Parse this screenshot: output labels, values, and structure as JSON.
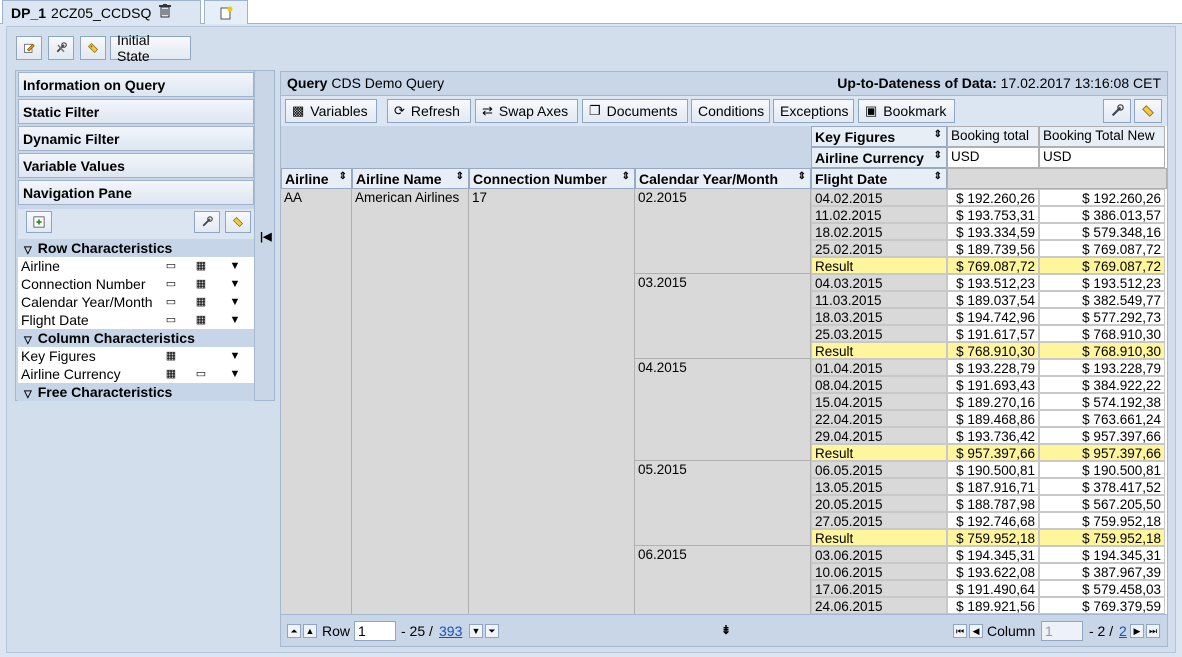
{
  "tabs": {
    "active": {
      "title": "DP_1",
      "subtitle": "2CZ05_CCDSQ"
    }
  },
  "toolbar": {
    "initial_state": "Initial State"
  },
  "nav": {
    "items": [
      "Information on Query",
      "Static Filter",
      "Dynamic Filter",
      "Variable Values",
      "Navigation Pane"
    ],
    "row_section": "Row Characteristics",
    "row_items": [
      "Airline",
      "Connection Number",
      "Calendar Year/Month",
      "Flight Date"
    ],
    "col_section": "Column Characteristics",
    "col_items": [
      "Key Figures",
      "Airline Currency"
    ],
    "free_section": "Free Characteristics"
  },
  "query": {
    "label": "Query",
    "name": "CDS Demo Query",
    "uptodate_label": "Up-to-Dateness of Data:",
    "uptodate_value": "17.02.2017 13:16:08 CET",
    "buttons": {
      "variables": "Variables",
      "refresh": "Refresh",
      "swap": "Swap Axes",
      "documents": "Documents",
      "conditions": "Conditions",
      "exceptions": "Exceptions",
      "bookmark": "Bookmark"
    }
  },
  "grid": {
    "kf_label": "Key Figures",
    "curr_label": "Airline Currency",
    "fd_label": "Flight Date",
    "col_booking_total": "Booking total",
    "col_booking_total_new": "Booking Total New",
    "currency": "USD",
    "row_headers": [
      "Airline",
      "Airline Name",
      "Connection Number",
      "Calendar Year/Month"
    ],
    "airline": "AA",
    "airline_name": "American Airlines",
    "connection": "17",
    "rows": [
      {
        "month": "02.2015",
        "date": "04.02.2015",
        "bt": "$ 192.260,26",
        "btn": "$ 192.260,26"
      },
      {
        "month": "",
        "date": "11.02.2015",
        "bt": "$ 193.753,31",
        "btn": "$ 386.013,57"
      },
      {
        "month": "",
        "date": "18.02.2015",
        "bt": "$ 193.334,59",
        "btn": "$ 579.348,16"
      },
      {
        "month": "",
        "date": "25.02.2015",
        "bt": "$ 189.739,56",
        "btn": "$ 769.087,72"
      },
      {
        "month": "",
        "date": "Result",
        "bt": "$ 769.087,72",
        "btn": "$ 769.087,72",
        "result": true
      },
      {
        "month": "03.2015",
        "date": "04.03.2015",
        "bt": "$ 193.512,23",
        "btn": "$ 193.512,23"
      },
      {
        "month": "",
        "date": "11.03.2015",
        "bt": "$ 189.037,54",
        "btn": "$ 382.549,77"
      },
      {
        "month": "",
        "date": "18.03.2015",
        "bt": "$ 194.742,96",
        "btn": "$ 577.292,73"
      },
      {
        "month": "",
        "date": "25.03.2015",
        "bt": "$ 191.617,57",
        "btn": "$ 768.910,30"
      },
      {
        "month": "",
        "date": "Result",
        "bt": "$ 768.910,30",
        "btn": "$ 768.910,30",
        "result": true
      },
      {
        "month": "04.2015",
        "date": "01.04.2015",
        "bt": "$ 193.228,79",
        "btn": "$ 193.228,79"
      },
      {
        "month": "",
        "date": "08.04.2015",
        "bt": "$ 191.693,43",
        "btn": "$ 384.922,22"
      },
      {
        "month": "",
        "date": "15.04.2015",
        "bt": "$ 189.270,16",
        "btn": "$ 574.192,38"
      },
      {
        "month": "",
        "date": "22.04.2015",
        "bt": "$ 189.468,86",
        "btn": "$ 763.661,24"
      },
      {
        "month": "",
        "date": "29.04.2015",
        "bt": "$ 193.736,42",
        "btn": "$ 957.397,66"
      },
      {
        "month": "",
        "date": "Result",
        "bt": "$ 957.397,66",
        "btn": "$ 957.397,66",
        "result": true
      },
      {
        "month": "05.2015",
        "date": "06.05.2015",
        "bt": "$ 190.500,81",
        "btn": "$ 190.500,81"
      },
      {
        "month": "",
        "date": "13.05.2015",
        "bt": "$ 187.916,71",
        "btn": "$ 378.417,52"
      },
      {
        "month": "",
        "date": "20.05.2015",
        "bt": "$ 188.787,98",
        "btn": "$ 567.205,50"
      },
      {
        "month": "",
        "date": "27.05.2015",
        "bt": "$ 192.746,68",
        "btn": "$ 759.952,18"
      },
      {
        "month": "",
        "date": "Result",
        "bt": "$ 759.952,18",
        "btn": "$ 759.952,18",
        "result": true
      },
      {
        "month": "06.2015",
        "date": "03.06.2015",
        "bt": "$ 194.345,31",
        "btn": "$ 194.345,31"
      },
      {
        "month": "",
        "date": "10.06.2015",
        "bt": "$ 193.622,08",
        "btn": "$ 387.967,39"
      },
      {
        "month": "",
        "date": "17.06.2015",
        "bt": "$ 191.490,64",
        "btn": "$ 579.458,03"
      },
      {
        "month": "",
        "date": "24.06.2015",
        "bt": "$ 189.921,56",
        "btn": "$ 769.379,59"
      }
    ]
  },
  "pager": {
    "row_label": "Row",
    "row_value": "1",
    "row_range": "- 25 /",
    "row_total": "393",
    "col_label": "Column",
    "col_value": "1",
    "col_range": "- 2 /",
    "col_total": "2"
  }
}
